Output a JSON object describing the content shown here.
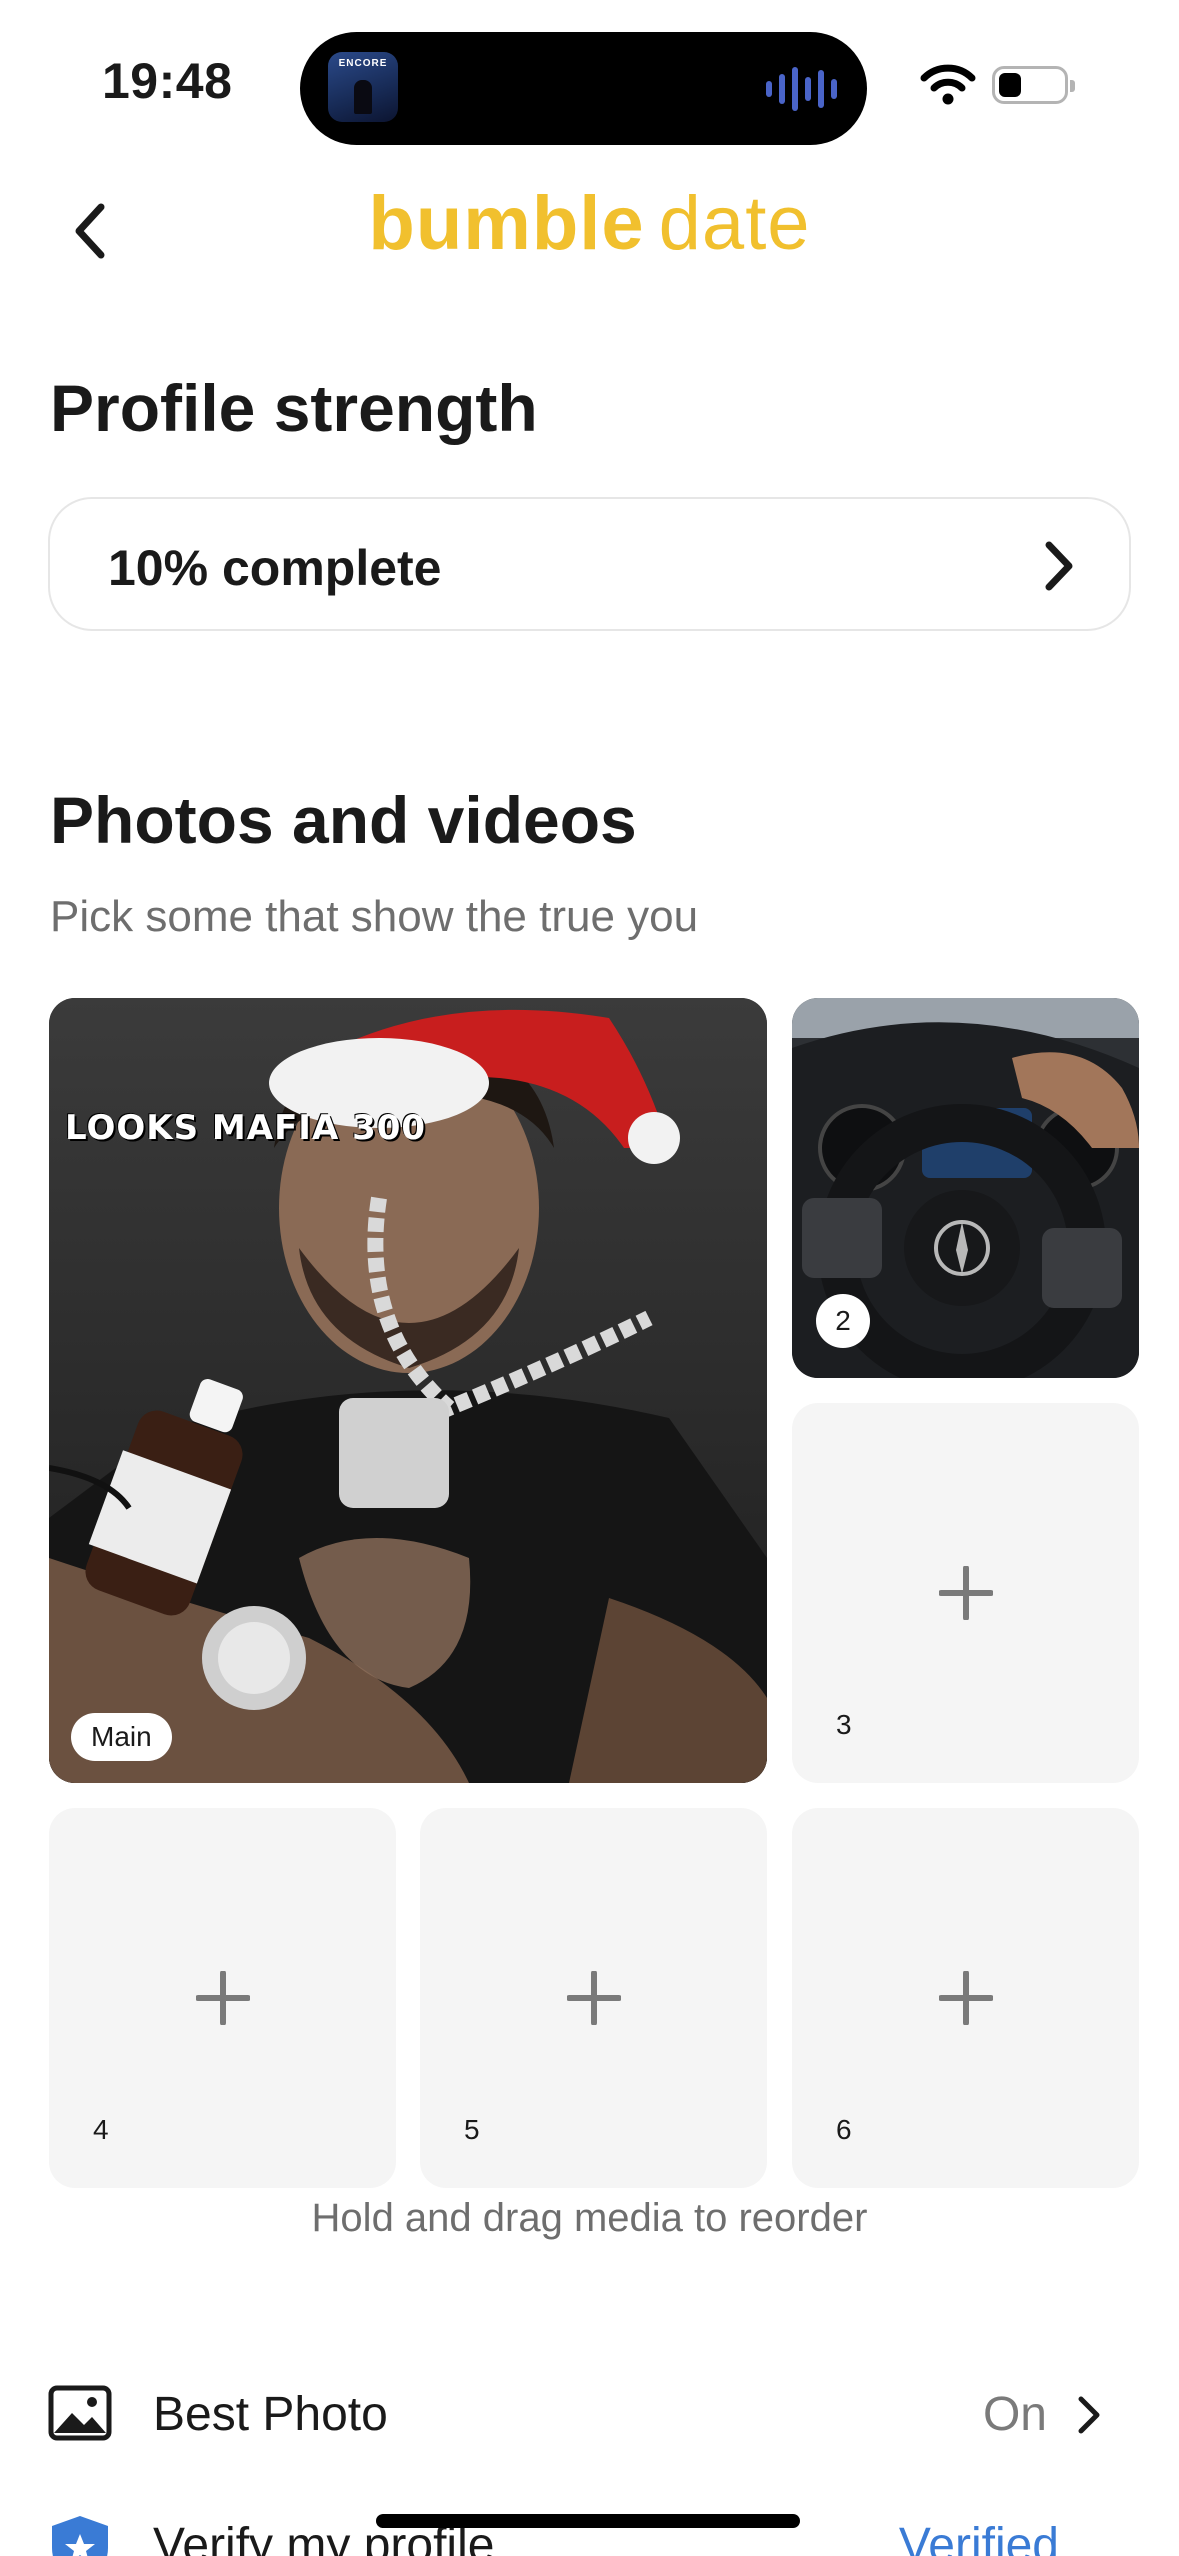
{
  "status_bar": {
    "time": "19:48",
    "album_text": "ENCORE"
  },
  "header": {
    "logo_part1": "bumble",
    "logo_part2": "date",
    "logo_color": "#f1c02e"
  },
  "profile_strength": {
    "title": "Profile strength",
    "status": "10% complete",
    "progress_percent": 10
  },
  "photos": {
    "title": "Photos and videos",
    "subtitle": "Pick some that show the true you",
    "main_badge": "Main",
    "main_overlay_text": "LOOKS MAFIA 300",
    "slots": [
      "2",
      "3",
      "4",
      "5",
      "6"
    ],
    "reorder_hint": "Hold and drag media to reorder"
  },
  "settings": {
    "best_photo": {
      "label": "Best Photo",
      "value": "On"
    },
    "verify": {
      "label": "Verify my profile",
      "value": "Verified",
      "value_color": "#3a7bd5"
    }
  }
}
